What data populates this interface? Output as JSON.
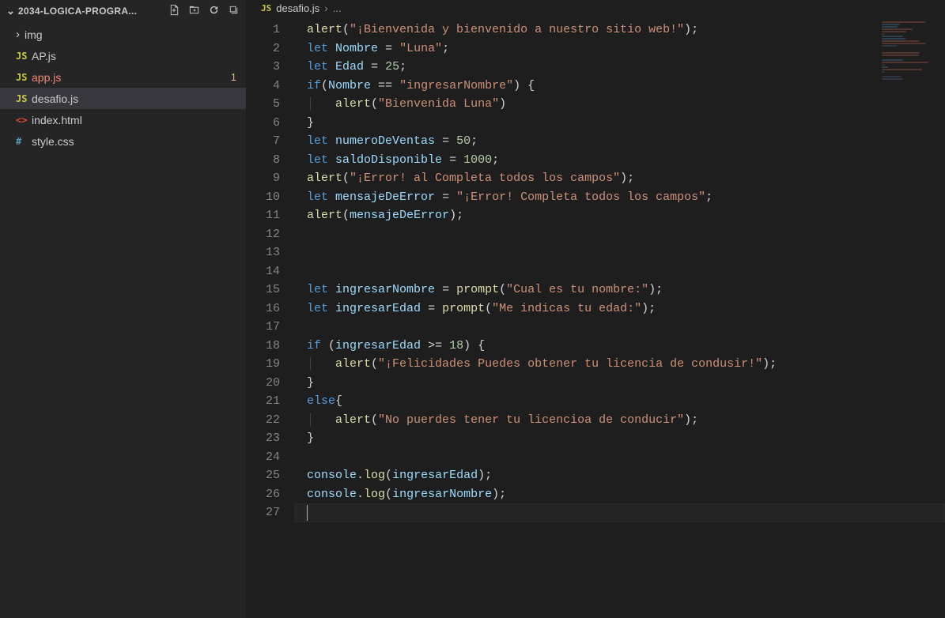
{
  "explorer": {
    "title": "2034-LOGICA-PROGRA...",
    "items": [
      {
        "kind": "folder",
        "label": "img"
      },
      {
        "kind": "js",
        "label": "AP.js"
      },
      {
        "kind": "js",
        "label": "app.js",
        "error": true,
        "badge": "1"
      },
      {
        "kind": "js",
        "label": "desafio.js",
        "active": true
      },
      {
        "kind": "html",
        "label": "index.html"
      },
      {
        "kind": "css",
        "label": "style.css"
      }
    ]
  },
  "breadcrumb": {
    "icon": "JS",
    "file": "desafio.js",
    "tail": "..."
  },
  "lineCount": 27,
  "code": {
    "l1": {
      "fn": "alert",
      "str": "\"¡Bienvenida y bienvenido a nuestro sitio web!\""
    },
    "l2": {
      "kw": "let",
      "var": "Nombre",
      "eq": " = ",
      "str": "\"Luna\""
    },
    "l3": {
      "kw": "let",
      "var": "Edad",
      "eq": " = ",
      "num": "25"
    },
    "l4": {
      "kw": "if",
      "var": "Nombre",
      "op": " == ",
      "str": "\"ingresarNombre\""
    },
    "l5": {
      "fn": "alert",
      "str": "\"Bienvenida Luna\""
    },
    "l7": {
      "kw": "let",
      "var": "numeroDeVentas",
      "eq": " = ",
      "num": "50"
    },
    "l8": {
      "kw": "let",
      "var": "saldoDisponible",
      "eq": " = ",
      "num": "1000"
    },
    "l9": {
      "fn": "alert",
      "str": "\"¡Error! al Completa todos los campos\""
    },
    "l10": {
      "kw": "let",
      "var": "mensajeDeError",
      "eq": " = ",
      "str": "\"¡Error! Completa todos los campos\""
    },
    "l11": {
      "fn": "alert",
      "var": "mensajeDeError"
    },
    "l15": {
      "kw": "let",
      "var": "ingresarNombre",
      "eq": " = ",
      "fn": "prompt",
      "str": "\"Cual es tu nombre:\""
    },
    "l16": {
      "kw": "let",
      "var": "ingresarEdad",
      "eq": " = ",
      "fn": "prompt",
      "str": "\"Me indicas tu edad:\""
    },
    "l18": {
      "kw": "if",
      "var": "ingresarEdad",
      "op": " >= ",
      "num": "18"
    },
    "l19": {
      "fn": "alert",
      "str": "\"¡Felicidades Puedes obtener tu licencia de condusir!\""
    },
    "l21": {
      "kw": "else"
    },
    "l22": {
      "fn": "alert",
      "str": "\"No puerdes tener tu licencioa de conducir\""
    },
    "l25": {
      "obj": "console",
      "fn": "log",
      "var": "ingresarEdad"
    },
    "l26": {
      "obj": "console",
      "fn": "log",
      "var": "ingresarNombre"
    }
  }
}
